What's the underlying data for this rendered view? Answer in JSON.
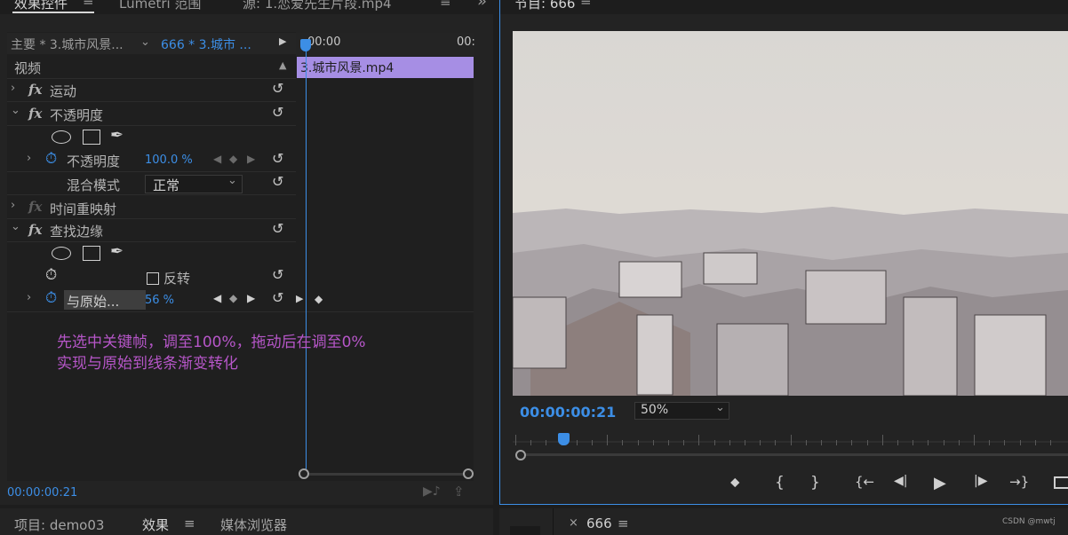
{
  "colors": {
    "accent": "#3c8ee6",
    "clip": "#a68ee4",
    "annotation": "#b656c8"
  },
  "tabs": {
    "effect_controls": "效果控件",
    "lumetri": "Lumetri 范围",
    "source": "源: 1.恋爱先生片段.mp4",
    "menu_icon": "≡",
    "overflow_icon": "»"
  },
  "clip_header": {
    "master": "主要 * 3.城市风景...",
    "sequence": "666 * 3.城市 ...",
    "play_icon": "▶"
  },
  "timeline": {
    "start_time": "00:00",
    "end_time": "00:",
    "clip_name": "3.城市风景.mp4"
  },
  "section": {
    "video": "视频"
  },
  "effects": {
    "motion": "运动",
    "opacity": "不透明度",
    "opacity_param": "不透明度",
    "opacity_value": "100.0 %",
    "blend_mode": "混合模式",
    "blend_value": "正常",
    "time_remap": "时间重映射",
    "find_edges": "查找边缘",
    "invert": "反转",
    "blend_original": "与原始...",
    "blend_original_value": "56 %"
  },
  "annotation": {
    "line1": "先选中关键帧，调至100%，拖动后在调至0%",
    "line2": "实现与原始到线条渐变转化"
  },
  "left_footer": {
    "timecode": "00:00:00:21"
  },
  "program_monitor": {
    "title": "节目: 666",
    "timecode": "00:00:00:21",
    "zoom": "50%"
  },
  "transport": {
    "marker": "⬥",
    "mark_in": "{",
    "mark_out": "}",
    "go_to_in": "{←",
    "step_back": "◀|",
    "play": "▶",
    "step_forward": "|▶",
    "go_to_out": "→}"
  },
  "bottom_tabs": {
    "project": "项目: demo03",
    "effects": "效果",
    "media_browser": "媒体浏览器",
    "sequence_tab": "666",
    "close": "×"
  },
  "watermark": "CSDN @mwtj"
}
